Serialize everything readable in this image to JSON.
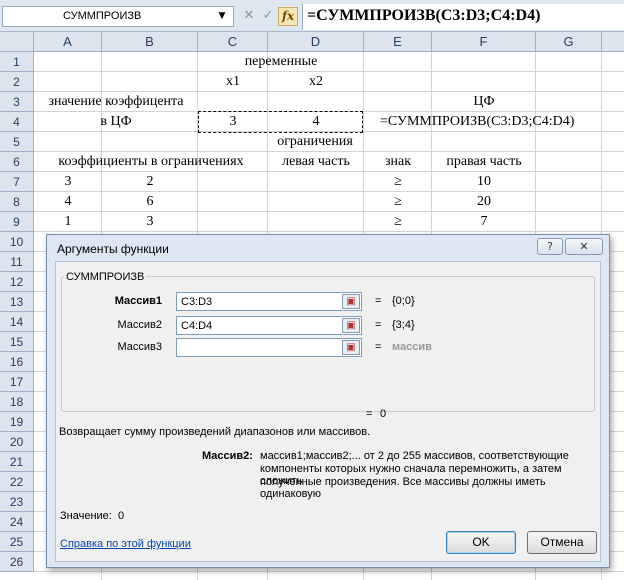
{
  "formula_bar": {
    "name_box": "СУММПРОИЗВ",
    "cancel_glyph": "✕",
    "enter_glyph": "✓",
    "fx_glyph": "fx",
    "formula": "=СУММПРОИЗВ(C3:D3;C4:D4)"
  },
  "columns": [
    "A",
    "B",
    "C",
    "D",
    "E",
    "F",
    "G"
  ],
  "rows": [
    "1",
    "2",
    "3",
    "4",
    "5",
    "6",
    "7",
    "8",
    "9",
    "10",
    "11",
    "12",
    "13",
    "14",
    "15",
    "16",
    "17",
    "18",
    "19",
    "20",
    "21",
    "22",
    "23",
    "24",
    "25",
    "26"
  ],
  "cells": {
    "c1": "переменные",
    "c2": "x1",
    "d2": "x2",
    "a3": "значение коэффицента",
    "f3": "ЦФ",
    "a4": "в ЦФ",
    "c4": "3",
    "d4": "4",
    "e4": "=СУММПРОИЗВ(C3:D3;C4:D4)",
    "c5": "ограничения",
    "a6": "коэффициенты в ограничениях",
    "d6": "левая часть",
    "e6": "знак",
    "f6": "правая часть",
    "a7": "3",
    "b7": "2",
    "e7": "≥",
    "f7": "10",
    "a8": "4",
    "b8": "6",
    "e8": "≥",
    "f8": "20",
    "a9": "1",
    "b9": "3",
    "e9": "≥",
    "f9": "7"
  },
  "dialog": {
    "title": "Аргументы функции",
    "help_glyph": "?",
    "close_glyph": "✕",
    "function_name": "СУММПРОИЗВ",
    "args": [
      {
        "label": "Массив1",
        "value": "C3:D3",
        "result": "{0;0}"
      },
      {
        "label": "Массив2",
        "value": "C4:D4",
        "result": "{3;4}"
      },
      {
        "label": "Массив3",
        "value": "",
        "result": "массив"
      }
    ],
    "equals": "=",
    "total_result": "0",
    "description": "Возвращает сумму произведений диапазонов или массивов.",
    "arg_desc_label": "Массив2:",
    "arg_desc_lines": [
      "массив1;массив2;... от 2 до 255 массивов, соответствующие",
      "компоненты которых нужно сначала перемножить, а затем сложить",
      "полученные произведения. Все массивы должны иметь одинаковую"
    ],
    "value_label": "Значение:",
    "value": "0",
    "help_link": "Справка по этой функции",
    "ok": "OK",
    "cancel": "Отмена"
  }
}
